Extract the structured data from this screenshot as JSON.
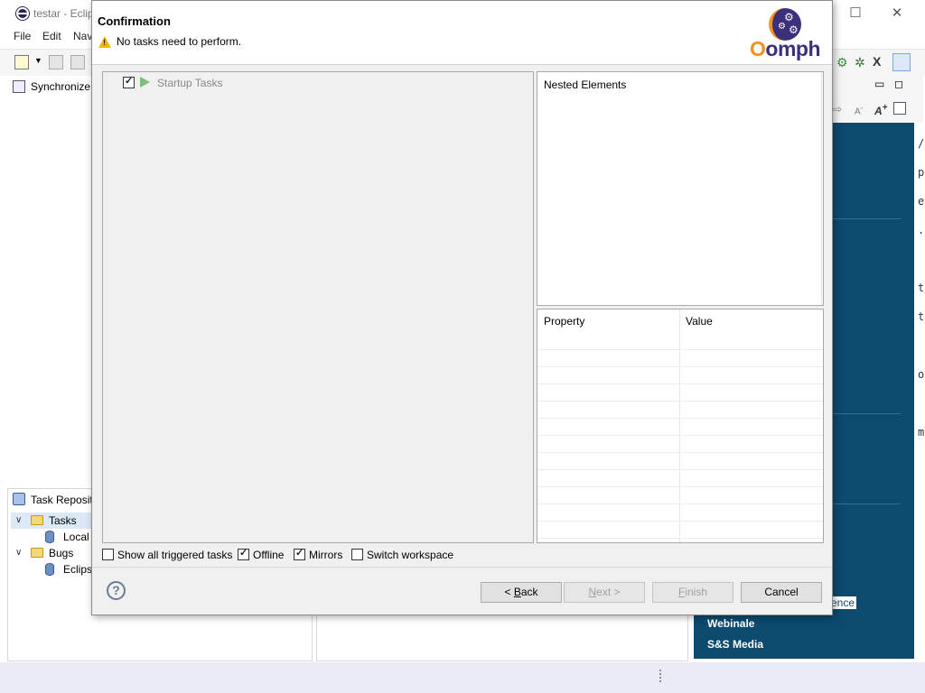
{
  "eclipse": {
    "window_title": "testar - Eclip",
    "menu": [
      "File",
      "Edit",
      "Nav"
    ],
    "synchronize_view": "Synchronize",
    "task_repositories": {
      "title": "Task Reposito",
      "tree": [
        {
          "label": "Tasks",
          "expanded": true,
          "selected": true
        },
        {
          "label": "Local",
          "child": true
        },
        {
          "label": "Bugs",
          "expanded": true
        },
        {
          "label": "Eclips",
          "child": true
        }
      ]
    },
    "welcome_links": [
      "ence",
      "Webinale",
      "S&S Media"
    ],
    "editor_fragments": [
      "/",
      "p",
      "e",
      ".",
      "t",
      "t",
      "o",
      "m"
    ]
  },
  "dialog": {
    "title": "Confirmation",
    "message": "No tasks need to perform.",
    "logo_text_accent": "O",
    "logo_text_rest": "omph",
    "tree": {
      "root_label": "Startup Tasks",
      "checked": true
    },
    "nested_elements_label": "Nested Elements",
    "properties": {
      "columns": [
        "Property",
        "Value"
      ]
    },
    "options": [
      {
        "label": "Show all triggered tasks",
        "checked": false
      },
      {
        "label": "Offline",
        "checked": true
      },
      {
        "label": "Mirrors",
        "checked": true
      },
      {
        "label": "Switch workspace",
        "checked": false
      }
    ],
    "buttons": {
      "back": {
        "prefix": "< ",
        "mnemonic": "B",
        "rest": "ack"
      },
      "next": {
        "mnemonic": "N",
        "rest": "ext >"
      },
      "finish": {
        "mnemonic": "F",
        "rest": "inish"
      },
      "cancel": "Cancel"
    },
    "help_label": "?"
  }
}
